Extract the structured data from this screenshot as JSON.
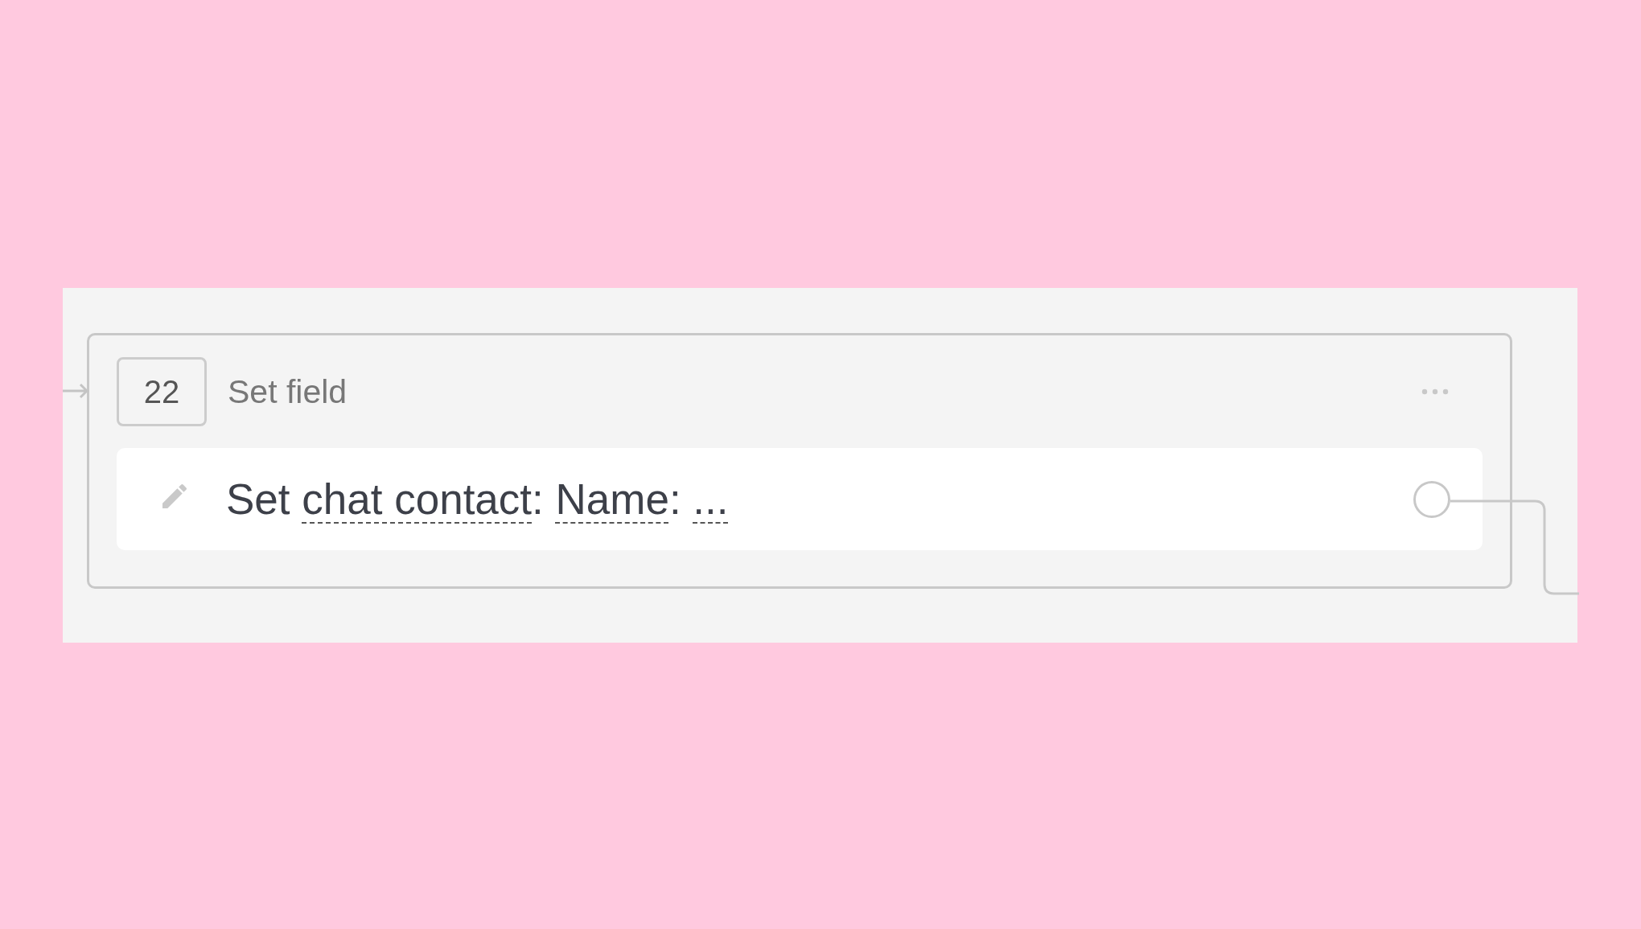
{
  "node": {
    "number": "22",
    "title": "Set field",
    "action": {
      "parts": [
        {
          "text": "Set ",
          "kind": "plain"
        },
        {
          "text": "chat contact",
          "kind": "variable"
        },
        {
          "text": ": ",
          "kind": "plain"
        },
        {
          "text": "Name",
          "kind": "variable"
        },
        {
          "text": ": ",
          "kind": "plain"
        },
        {
          "text": "...",
          "kind": "variable"
        }
      ]
    }
  }
}
